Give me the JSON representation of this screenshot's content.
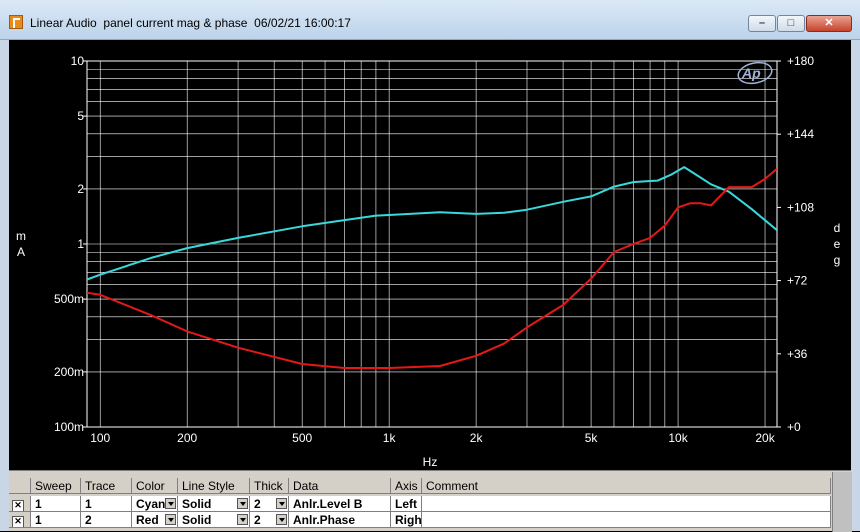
{
  "window": {
    "title": "Linear Audio  panel current mag & phase  06/02/21 16:00:17",
    "minimize_label": "–",
    "maximize_label": "□",
    "close_label": "✕"
  },
  "logo_text": "Ap",
  "chart_data": {
    "type": "line",
    "x_scale": "log",
    "xlim": [
      90,
      22000
    ],
    "xlabel": "Hz",
    "x_ticks": [
      {
        "v": 100,
        "label": "100"
      },
      {
        "v": 200,
        "label": "200"
      },
      {
        "v": 500,
        "label": "500"
      },
      {
        "v": 1000,
        "label": "1k"
      },
      {
        "v": 2000,
        "label": "2k"
      },
      {
        "v": 5000,
        "label": "5k"
      },
      {
        "v": 10000,
        "label": "10k"
      },
      {
        "v": 20000,
        "label": "20k"
      }
    ],
    "y_left": {
      "label_lines": [
        "m",
        "A"
      ],
      "scale": "log",
      "lim": [
        100,
        10000
      ],
      "ticks": [
        {
          "v": 10000,
          "label": "10"
        },
        {
          "v": 5000,
          "label": "5"
        },
        {
          "v": 2000,
          "label": "2"
        },
        {
          "v": 1000,
          "label": "1"
        },
        {
          "v": 500,
          "label": "500m"
        },
        {
          "v": 200,
          "label": "200m"
        },
        {
          "v": 100,
          "label": "100m"
        }
      ]
    },
    "y_right": {
      "label_lines": [
        "d",
        "e",
        "g"
      ],
      "scale": "linear",
      "lim": [
        0,
        180
      ],
      "ticks": [
        {
          "v": 180,
          "label": "+180"
        },
        {
          "v": 144,
          "label": "+144"
        },
        {
          "v": 108,
          "label": "+108"
        },
        {
          "v": 72,
          "label": "+72"
        },
        {
          "v": 36,
          "label": "+36"
        },
        {
          "v": 0,
          "label": "+0"
        }
      ]
    },
    "grid": true,
    "series": [
      {
        "axis": "left",
        "color": "#39d8dc",
        "x": [
          90,
          100,
          150,
          200,
          300,
          500,
          700,
          900,
          1000,
          1500,
          2000,
          2500,
          3000,
          4000,
          5000,
          6000,
          7000,
          8000,
          8500,
          9500,
          10500,
          11500,
          13000,
          15000,
          18000,
          22000
        ],
        "y": [
          640,
          680,
          840,
          950,
          1080,
          1250,
          1350,
          1430,
          1440,
          1490,
          1460,
          1480,
          1540,
          1700,
          1820,
          2060,
          2180,
          2210,
          2220,
          2400,
          2630,
          2400,
          2120,
          1930,
          1550,
          1190
        ]
      },
      {
        "axis": "right",
        "color": "#e51818",
        "x": [
          90,
          100,
          150,
          200,
          300,
          500,
          700,
          900,
          1000,
          1500,
          2000,
          2500,
          3000,
          4000,
          5000,
          6000,
          7000,
          8000,
          9000,
          10000,
          11000,
          12000,
          13000,
          15000,
          18000,
          20000,
          22000
        ],
        "y": [
          66,
          65,
          55,
          47,
          39,
          31,
          29,
          29,
          29,
          30,
          35,
          41,
          49,
          60,
          73,
          86,
          90,
          93,
          99,
          108,
          110,
          110,
          109,
          118,
          118,
          122,
          127
        ]
      }
    ]
  },
  "trace_table": {
    "headers": [
      "Sweep",
      "Trace",
      "Color",
      "Line Style",
      "Thick",
      "Data",
      "Axis",
      "Comment"
    ],
    "rows": [
      {
        "checked": "✕",
        "sweep": "1",
        "trace": "1",
        "color": "Cyan",
        "style": "Solid",
        "thick": "2",
        "data": "Anlr.Level B",
        "axis": "Left",
        "comment": ""
      },
      {
        "checked": "✕",
        "sweep": "1",
        "trace": "2",
        "color": "Red",
        "style": "Solid",
        "thick": "2",
        "data": "Anlr.Phase",
        "axis": "Righ",
        "comment": ""
      }
    ]
  }
}
